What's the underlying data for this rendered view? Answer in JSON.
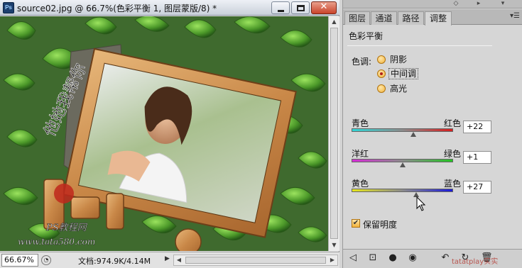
{
  "document": {
    "title": "source02.jpg @ 66.7%(色彩平衡 1, 图层蒙版/8) *",
    "app_icon": "Ps",
    "window_controls": {
      "minimize": "minimize-icon",
      "maximize": "maximize-icon",
      "close": "✕"
    },
    "canvas_text": {
      "calligraphy": "他她我帮你",
      "site_cn": "PS教程网",
      "site_url": "www.tata580.com"
    },
    "status": {
      "zoom": "66.67%",
      "doc_info": "文档:974.9K/4.14M"
    }
  },
  "panel": {
    "tabs": [
      "图层",
      "通道",
      "路径",
      "调整"
    ],
    "active_tab": "调整",
    "adjustment_title": "色彩平衡",
    "tone": {
      "label": "色调:",
      "options": [
        "阴影",
        "中间调",
        "高光"
      ],
      "selected": "中间调"
    },
    "sliders": [
      {
        "left": "青色",
        "right": "红色",
        "value": "+22",
        "amount": 22,
        "colors": [
          "#2fd6d6",
          "#d81e1e"
        ]
      },
      {
        "left": "洋红",
        "right": "绿色",
        "value": "+1",
        "amount": 1,
        "colors": [
          "#d62bd6",
          "#23c423"
        ]
      },
      {
        "left": "黄色",
        "right": "蓝色",
        "value": "+27",
        "amount": 27,
        "colors": [
          "#e6e61a",
          "#1a1ad8"
        ]
      }
    ],
    "preserve_luminosity": {
      "label": "保留明度",
      "checked": true
    },
    "watermark": "tatatplay实实"
  }
}
